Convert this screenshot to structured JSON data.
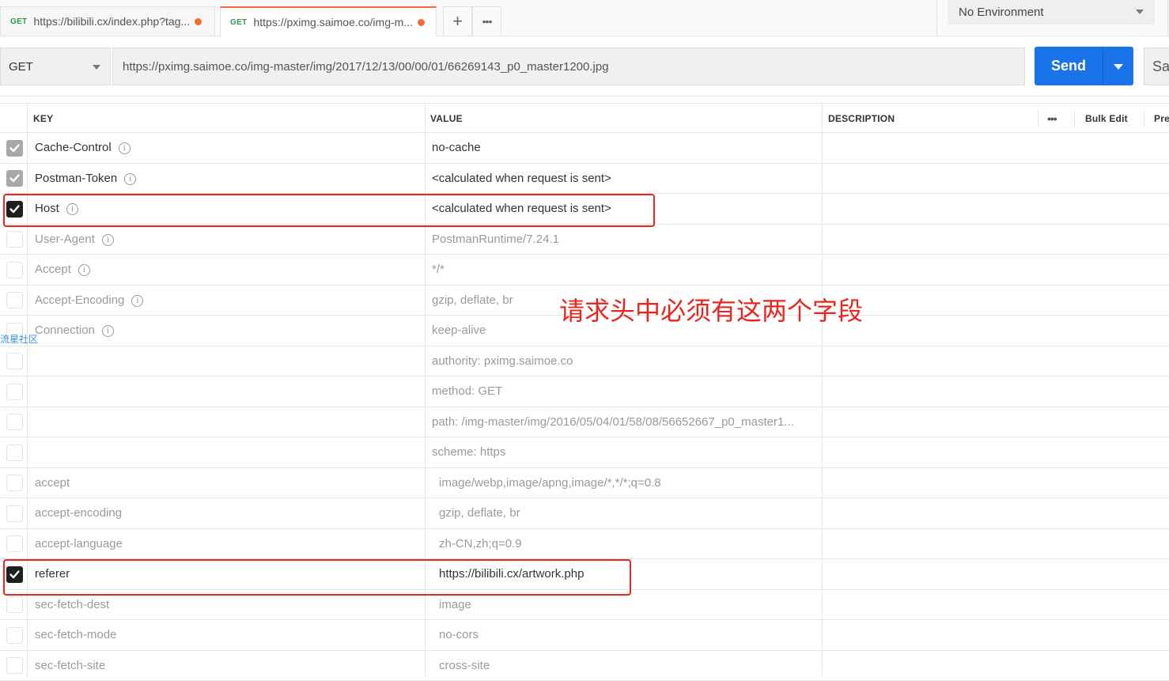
{
  "tabs": [
    {
      "method": "GET",
      "url": "https://bilibili.cx/index.php?tag...",
      "unsaved": true,
      "active": false
    },
    {
      "method": "GET",
      "url": "https://pximg.saimoe.co/img-m...",
      "unsaved": true,
      "active": true
    }
  ],
  "tab_actions": {
    "add_icon": "plus-icon",
    "more_icon": "more-icon",
    "add_glyph": "+",
    "more_glyph": "•••"
  },
  "environment": {
    "selected": "No Environment"
  },
  "request": {
    "method": "GET",
    "url": "https://pximg.saimoe.co/img-master/img/2017/12/13/00/00/01/66269143_p0_master1200.jpg",
    "send_label": "Send",
    "save_label": "Sa"
  },
  "table": {
    "headers": {
      "key": "KEY",
      "value": "VALUE",
      "description": "DESCRIPTION",
      "more": "•••",
      "bulk_edit": "Bulk Edit",
      "presets": "Pre"
    },
    "rows": [
      {
        "checked": "grey",
        "key": "Cache-Control",
        "info": true,
        "value": "no-cache",
        "dim": false
      },
      {
        "checked": "grey",
        "key": "Postman-Token",
        "info": true,
        "value": "<calculated when request is sent>",
        "dim": false
      },
      {
        "checked": "black",
        "key": "Host",
        "info": true,
        "value": "<calculated when request is sent>",
        "dim": false
      },
      {
        "checked": "none",
        "key": "User-Agent",
        "info": true,
        "value": "PostmanRuntime/7.24.1",
        "dim": true
      },
      {
        "checked": "none",
        "key": "Accept",
        "info": true,
        "value": "*/*",
        "dim": true
      },
      {
        "checked": "none",
        "key": "Accept-Encoding",
        "info": true,
        "value": "gzip, deflate, br",
        "dim": true
      },
      {
        "checked": "none",
        "key": "Connection",
        "info": true,
        "value": "keep-alive",
        "dim": true
      },
      {
        "checked": "none",
        "key": "",
        "info": false,
        "value": "authority: pximg.saimoe.co",
        "dim": true
      },
      {
        "checked": "none",
        "key": "",
        "info": false,
        "value": "method: GET",
        "dim": true
      },
      {
        "checked": "none",
        "key": "",
        "info": false,
        "value": "path: /img-master/img/2016/05/04/01/58/08/56652667_p0_master1...",
        "dim": true
      },
      {
        "checked": "none",
        "key": "",
        "info": false,
        "value": "scheme: https",
        "dim": true
      },
      {
        "checked": "none",
        "key": "accept",
        "info": false,
        "value": "image/webp,image/apng,image/*,*/*;q=0.8",
        "dim": true,
        "indent": true
      },
      {
        "checked": "none",
        "key": "accept-encoding",
        "info": false,
        "value": "gzip, deflate, br",
        "dim": true,
        "indent": true
      },
      {
        "checked": "none",
        "key": "accept-language",
        "info": false,
        "value": "zh-CN,zh;q=0.9",
        "dim": true,
        "indent": true
      },
      {
        "checked": "black",
        "key": "referer",
        "info": false,
        "value": "https://bilibili.cx/artwork.php",
        "dim": false,
        "indent": true
      },
      {
        "checked": "none",
        "key": "sec-fetch-dest",
        "info": false,
        "value": "image",
        "dim": true,
        "indent": true
      },
      {
        "checked": "none",
        "key": "sec-fetch-mode",
        "info": false,
        "value": "no-cors",
        "dim": true,
        "indent": true
      },
      {
        "checked": "none",
        "key": "sec-fetch-site",
        "info": false,
        "value": "cross-site",
        "dim": true,
        "indent": true
      }
    ]
  },
  "annotation": {
    "text": "请求头中必须有这两个字段",
    "color": "#e8261e"
  },
  "watermark": {
    "text": "流星社区"
  },
  "colors": {
    "accent": "#f26b3a",
    "send": "#1a73e8",
    "get_method": "#2b9a4b"
  }
}
